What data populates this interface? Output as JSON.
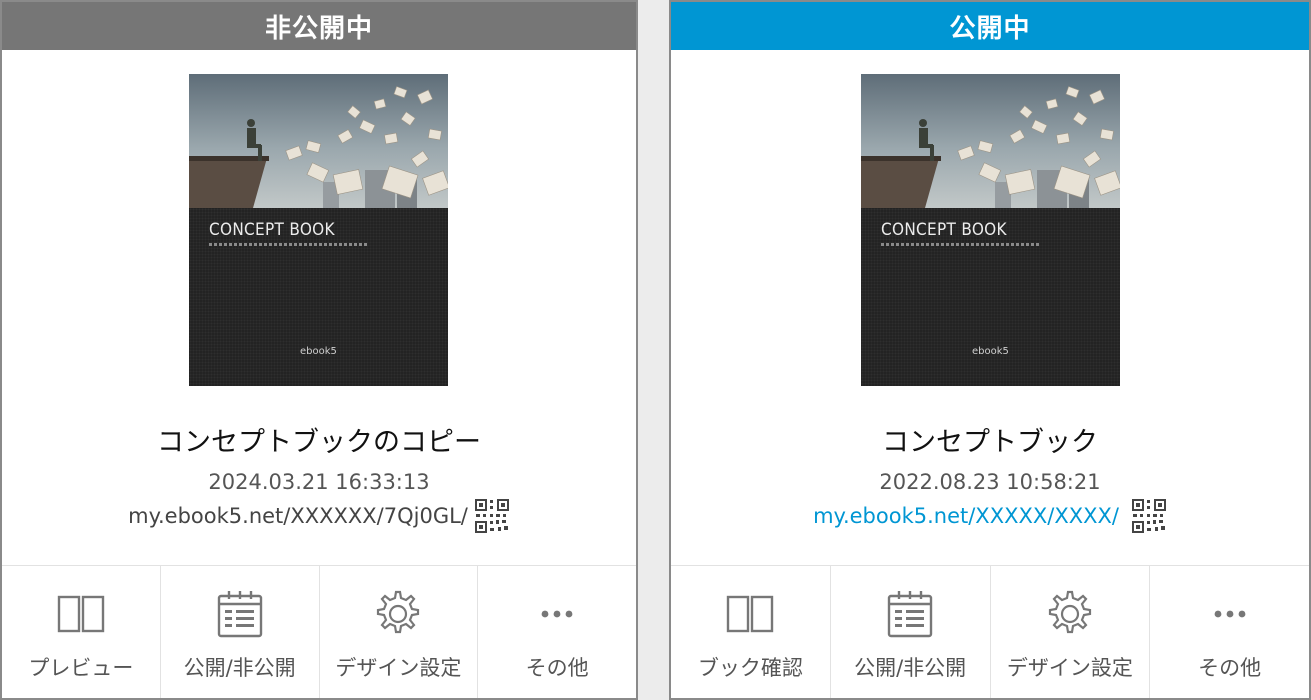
{
  "cards": [
    {
      "status": "非公開中",
      "status_color": "#767676",
      "cover": {
        "title": "CONCEPT BOOK",
        "logo": "ebook5"
      },
      "title": "コンセプトブックのコピー",
      "date": "2024.03.21 16:33:13",
      "url": "my.ebook5.net/XXXXXX/7Qj0GL/",
      "url_color": "#444444",
      "qr_icon": "qr-code-icon",
      "actions": [
        {
          "label": "プレビュー",
          "icon": "book-open-icon"
        },
        {
          "label": "公開/非公開",
          "icon": "calendar-icon"
        },
        {
          "label": "デザイン設定",
          "icon": "gear-icon"
        },
        {
          "label": "その他",
          "icon": "more-icon"
        }
      ]
    },
    {
      "status": "公開中",
      "status_color": "#0096d3",
      "cover": {
        "title": "CONCEPT BOOK",
        "logo": "ebook5"
      },
      "title": "コンセプトブック",
      "date": "2022.08.23 10:58:21",
      "url": "my.ebook5.net/XXXXX/XXXX/",
      "url_color": "#0096d3",
      "qr_icon": "qr-code-icon",
      "actions": [
        {
          "label": "ブック確認",
          "icon": "book-open-icon"
        },
        {
          "label": "公開/非公開",
          "icon": "calendar-icon"
        },
        {
          "label": "デザイン設定",
          "icon": "gear-icon"
        },
        {
          "label": "その他",
          "icon": "more-icon"
        }
      ]
    }
  ]
}
